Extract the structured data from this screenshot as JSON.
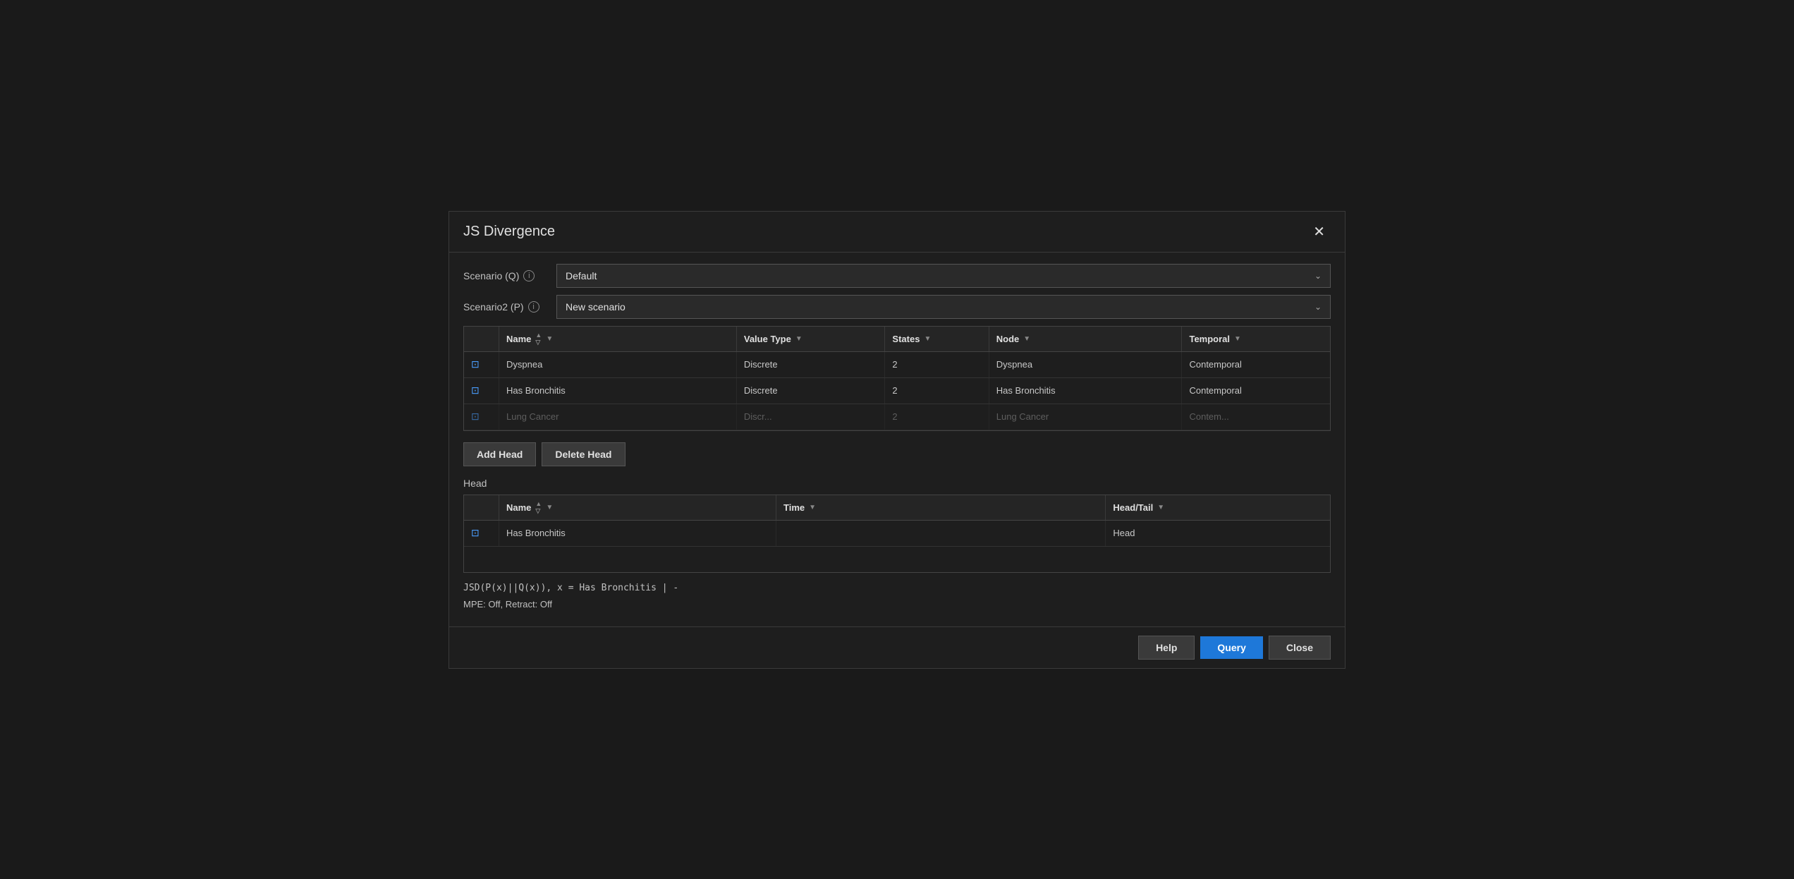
{
  "dialog": {
    "title": "JS Divergence",
    "close_label": "✕"
  },
  "scenario_q": {
    "label": "Scenario (Q)",
    "value": "Default",
    "chevron": "⌄"
  },
  "scenario_p": {
    "label": "Scenario2 (P)",
    "value": "New scenario",
    "chevron": "⌄"
  },
  "main_table": {
    "columns": [
      {
        "id": "icon",
        "label": ""
      },
      {
        "id": "name",
        "label": "Name"
      },
      {
        "id": "valuetype",
        "label": "Value Type"
      },
      {
        "id": "states",
        "label": "States"
      },
      {
        "id": "node",
        "label": "Node"
      },
      {
        "id": "temporal",
        "label": "Temporal"
      }
    ],
    "rows": [
      {
        "icon": "⊡",
        "name": "Dyspnea",
        "valuetype": "Discrete",
        "states": "2",
        "node": "Dyspnea",
        "temporal": "Contemporal"
      },
      {
        "icon": "⊡",
        "name": "Has Bronchitis",
        "valuetype": "Discrete",
        "states": "2",
        "node": "Has Bronchitis",
        "temporal": "Contemporal"
      },
      {
        "icon": "⊡",
        "name": "Lung Cancer",
        "valuetype": "Discr...",
        "states": "2",
        "node": "Lung Cancer",
        "temporal": "Contem..."
      }
    ]
  },
  "buttons": {
    "add_head": "Add Head",
    "delete_head": "Delete Head"
  },
  "head_section": {
    "label": "Head",
    "columns": [
      {
        "id": "icon",
        "label": ""
      },
      {
        "id": "name",
        "label": "Name"
      },
      {
        "id": "time",
        "label": "Time"
      },
      {
        "id": "headtail",
        "label": "Head/Tail"
      }
    ],
    "rows": [
      {
        "icon": "⊡",
        "name": "Has Bronchitis",
        "time": "",
        "headtail": "Head"
      }
    ]
  },
  "formula": "JSD(P(x)||Q(x)), x = Has Bronchitis | -",
  "mpe": "MPE: Off, Retract: Off",
  "footer": {
    "help_label": "Help",
    "query_label": "Query",
    "close_label": "Close"
  }
}
